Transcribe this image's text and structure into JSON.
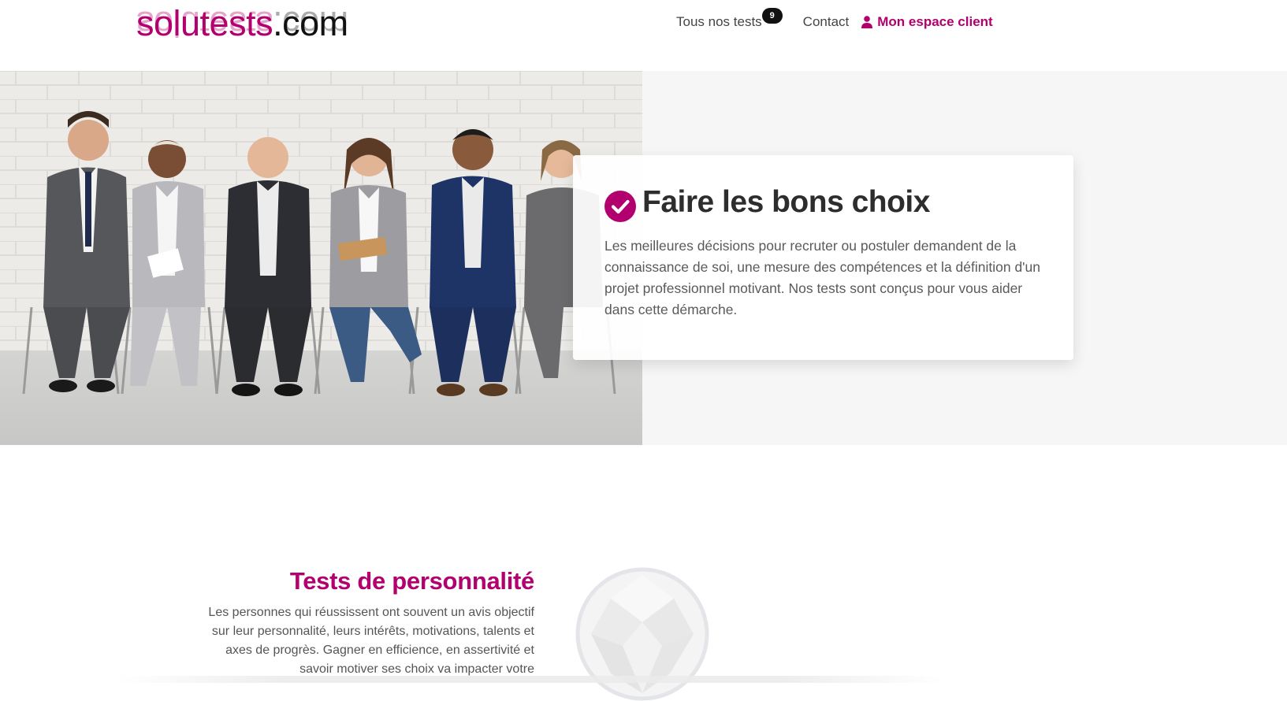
{
  "header": {
    "logo": {
      "brand": "solutests",
      "tld": ".com"
    },
    "nav": {
      "tests_label": "Tous nos tests",
      "tests_badge": "9",
      "contact_label": "Contact",
      "account_label": "Mon espace client"
    }
  },
  "hero": {
    "title": "Faire les bons choix",
    "text": "Les meilleures décisions pour recruter ou postuler demandent de la connaissance de soi, une mesure des compétences et la définition d'un projet professionnel motivant. Nos tests sont conçus pour vous aider dans cette démarche."
  },
  "section": {
    "title": "Tests de personnalité",
    "text": "Les personnes qui réussissent ont souvent un avis objectif sur leur personnalité, leurs intérêts, motivations, talents et axes de progrès. Gagner en efficience, en assertivité et savoir motiver ses choix va impacter votre"
  },
  "colors": {
    "brand": "#b2006e",
    "badge": "#111111",
    "hero_bg": "#f6f6f6"
  },
  "icons": {
    "account": "user-icon",
    "title": "check-circle-icon",
    "section": "gem-icon"
  }
}
